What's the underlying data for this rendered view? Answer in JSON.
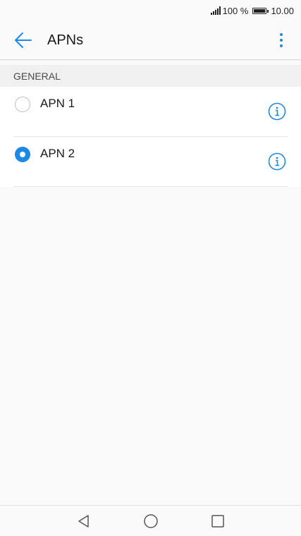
{
  "status_bar": {
    "battery": "100 %",
    "time": "10.00",
    "icons": [
      "signal-icon",
      "battery-icon"
    ]
  },
  "app_bar": {
    "title": "APNs",
    "back_icon": "back-arrow-icon",
    "menu_icon": "more-vertical-icon"
  },
  "section": {
    "header": "GENERAL"
  },
  "apn_items": [
    {
      "name": "APN 1",
      "selected": false
    },
    {
      "name": "APN 2",
      "selected": true
    }
  ],
  "nav_bar": {
    "icons": [
      "back-triangle-icon",
      "home-circle-icon",
      "recents-square-icon"
    ]
  },
  "colors": {
    "accent": "#1e88e5",
    "background": "#fafafa",
    "header_bg": "#f0f0f0"
  }
}
